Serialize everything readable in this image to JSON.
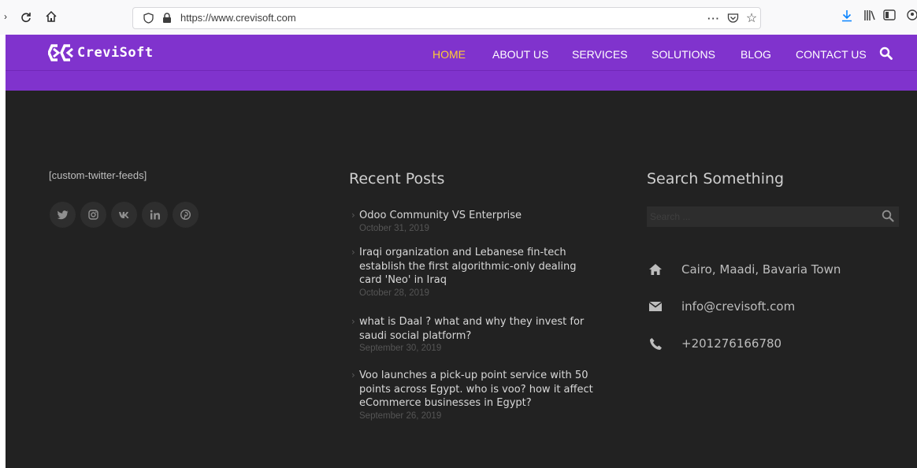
{
  "browser": {
    "url": "https://www.crevisoft.com",
    "page_actions_label": "···"
  },
  "header": {
    "logo_text": "CreviSoft",
    "menu": [
      {
        "label": "HOME",
        "active": true
      },
      {
        "label": "ABOUT US",
        "active": false
      },
      {
        "label": "SERVICES",
        "active": false
      },
      {
        "label": "SOLUTIONS",
        "active": false
      },
      {
        "label": "BLOG",
        "active": false
      },
      {
        "label": "CONTACT US",
        "active": false
      }
    ]
  },
  "footer": {
    "twitter_shortcode": "[custom-twitter-feeds]",
    "social": [
      {
        "icon": "twitter-icon",
        "glyph": "𝕥"
      },
      {
        "icon": "instagram-icon",
        "glyph": "◎"
      },
      {
        "icon": "vk-icon",
        "glyph": "vk"
      },
      {
        "icon": "linkedin-icon",
        "glyph": "in"
      },
      {
        "icon": "pinterest-icon",
        "glyph": "℗"
      }
    ],
    "recent_posts": {
      "title": "Recent Posts",
      "items": [
        {
          "title": "Odoo Community VS Enterprise",
          "date": "October 31, 2019"
        },
        {
          "title": "Iraqi organization and Lebanese fin-tech establish the first algorithmic-only dealing card 'Neo' in Iraq",
          "date": "October 28, 2019"
        },
        {
          "title": "what is Daal ? what and why they invest for saudi social platform?",
          "date": "September 30, 2019"
        },
        {
          "title": "Voo launches a pick-up point service with 50 points across Egypt. who is voo? how it affect eCommerce businesses in Egypt?",
          "date": "September 26, 2019"
        }
      ]
    },
    "search": {
      "title": "Search Something",
      "placeholder": "Search ..."
    },
    "contact": {
      "address": "Cairo, Maadi, Bavaria Town",
      "email": "info@crevisoft.com",
      "phone": "+201276166780"
    }
  },
  "colors": {
    "header_purple": "#8033cd",
    "active_menu": "#ffcc33",
    "footer_bg": "#222222",
    "browser_download_blue": "#0a84ff"
  }
}
